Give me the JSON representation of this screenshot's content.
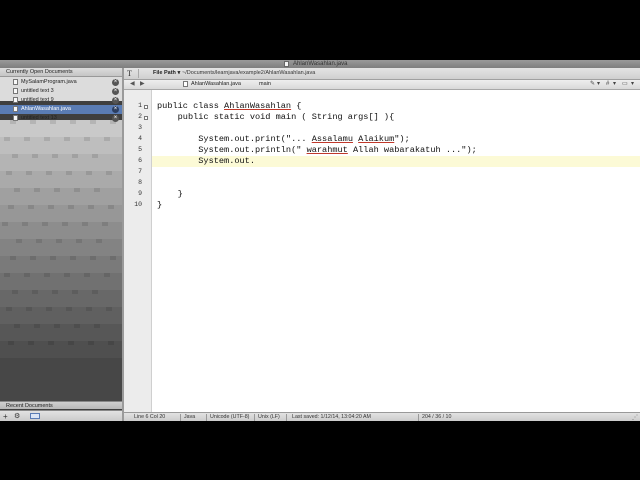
{
  "window": {
    "title": "AhlanWasahlan.java"
  },
  "sidebar": {
    "header": "Currently Open Documents",
    "documents": [
      {
        "name": "MySalamProgram.java",
        "selected": false
      },
      {
        "name": "untitled text 3",
        "selected": false
      },
      {
        "name": "untitled text 9",
        "selected": false
      },
      {
        "name": "AhlanWasahlan.java",
        "selected": true
      },
      {
        "name": "untitled text 13",
        "selected": false
      }
    ],
    "recent_header": "Recent Documents",
    "bottom": {
      "plus_icon": "+",
      "gear_icon": "⚙"
    }
  },
  "pathbar": {
    "text_icon": "T",
    "label": "File Path ▾",
    "path": ": ~/Documents/learnjava/example2/AhlanWasahlan.java"
  },
  "navbar": {
    "back": "◀",
    "forward": "▶",
    "file": "AhlanWasahlan.java",
    "symbol": "main",
    "right_icons": [
      "✎",
      "▾",
      "#",
      "▾",
      "▭",
      "▾"
    ]
  },
  "editor": {
    "line_numbers": [
      "1",
      "2",
      "3",
      "4",
      "5",
      "6",
      "7",
      "8",
      "9",
      "10"
    ],
    "current_line": 6,
    "lines": [
      "public class AhlanWasahlan {",
      "    public static void main ( String args[] ){",
      "",
      "        System.out.print(\"... Assalamu Alaikum\");",
      "        System.out.println(\" warahmut Allah wabarakatuh ...\");",
      "        System.out.",
      "",
      "",
      "    }",
      "}"
    ]
  },
  "status": {
    "position": "Line 6 Col 20",
    "language": "Java",
    "encoding": "Unicode (UTF-8)",
    "line_endings": "Unix (LF)",
    "saved": "Last saved: 1/12/14, 13:04:20 AM",
    "stats": "204 / 36 / 10"
  }
}
